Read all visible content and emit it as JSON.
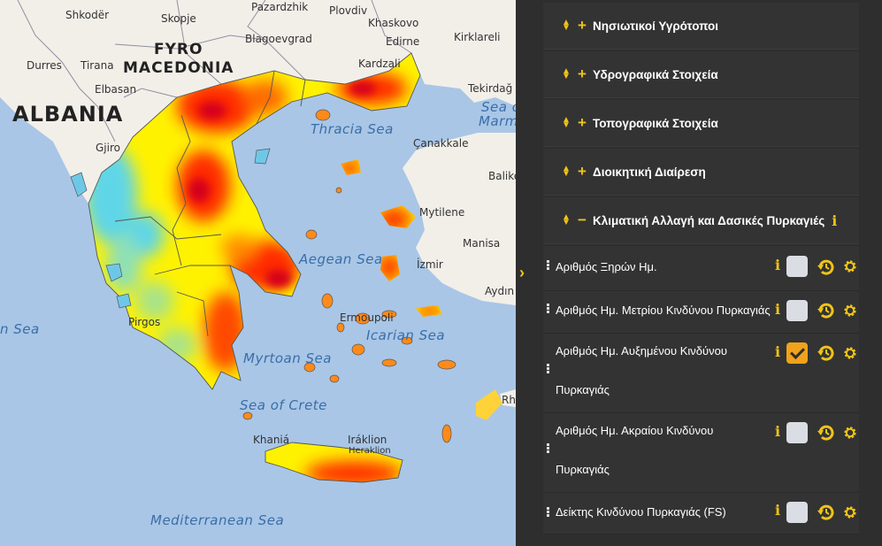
{
  "map": {
    "labels": {
      "albania": "ALBANIA",
      "fyro": "FYRO",
      "macedonia": "MACEDONIA",
      "shkoder": "Shkodër",
      "skopje": "Skopje",
      "pazardzhik": "Pazardzhik",
      "plovdiv": "Plovdiv",
      "khaskovo": "Khaskovo",
      "edirne": "Edirne",
      "kirklareli": "Kirklareli",
      "blagoevgrad": "Blagoevgrad",
      "kardzali": "Kardzali",
      "durres": "Durres",
      "tirana": "Tirana",
      "elbasan": "Elbasan",
      "tekirdag": "Tekirdağ",
      "sea_of_marmara_1": "Sea o",
      "sea_of_marmara_2": "Marma",
      "thracian_sea": "Thracia  Sea",
      "canakkale": "Çanakkale",
      "gjiro": "Gjiro",
      "balike": "Balike",
      "mytilene": "Mytilene",
      "manisa": "Manisa",
      "aegean_sea": "Aegean Sea",
      "izmir": "İzmir",
      "aydin": "Aydın",
      "ian_sea": "n Sea",
      "pirgos": "Pirgos",
      "ermoupoli": "Ermoupoli",
      "icarian_sea": "Icarian Sea",
      "myrtoan_sea": "Myrtoan Sea",
      "sea_of_crete": "Sea of Crete",
      "rh": "Rh",
      "chania": "Khaniá",
      "iraklion": "Iráklion",
      "heraklion": "Heraklion",
      "mediterranean": "Mediterranean Sea"
    }
  },
  "panel": {
    "sections": [
      {
        "title": "Νησιωτικοί Υγρότοποι",
        "expanded": false,
        "info": false
      },
      {
        "title": "Υδρογραφικά Στοιχεία",
        "expanded": false,
        "info": false
      },
      {
        "title": "Τοπογραφικά Στοιχεία",
        "expanded": false,
        "info": false
      },
      {
        "title": "Διοικητική Διαίρεση",
        "expanded": false,
        "info": false
      },
      {
        "title": "Κλιματική Αλλαγή και Δασικές Πυρκαγιές",
        "expanded": true,
        "info": true
      }
    ],
    "info_glyph": "i",
    "toggle_glyph": "›",
    "layers": [
      {
        "line1": "Αριθμός Ξηρών Ημ.",
        "line2": "",
        "checked": false
      },
      {
        "line1": "Αριθμός Ημ. Μετρίου Κινδύνου Πυρκαγιάς",
        "line2": "",
        "checked": false
      },
      {
        "line1": "Αριθμός Ημ. Αυξημένου Κινδύνου",
        "line2": "Πυρκαγιάς",
        "checked": true
      },
      {
        "line1": "Αριθμός Ημ. Ακραίου Κινδύνου",
        "line2": "Πυρκαγιάς",
        "checked": false
      },
      {
        "line1": "Δείκτης Κινδύνου Πυρκαγιάς (FS)",
        "line2": "",
        "checked": false
      }
    ]
  },
  "colors": {
    "accent": "#f0c417",
    "checked": "#f0a21b",
    "sea": "#a9c6e6",
    "land": "#f2efe9",
    "heat_low": "#5fd6e8",
    "heat_mid": "#fff200",
    "heat_high": "#ff2a00"
  }
}
